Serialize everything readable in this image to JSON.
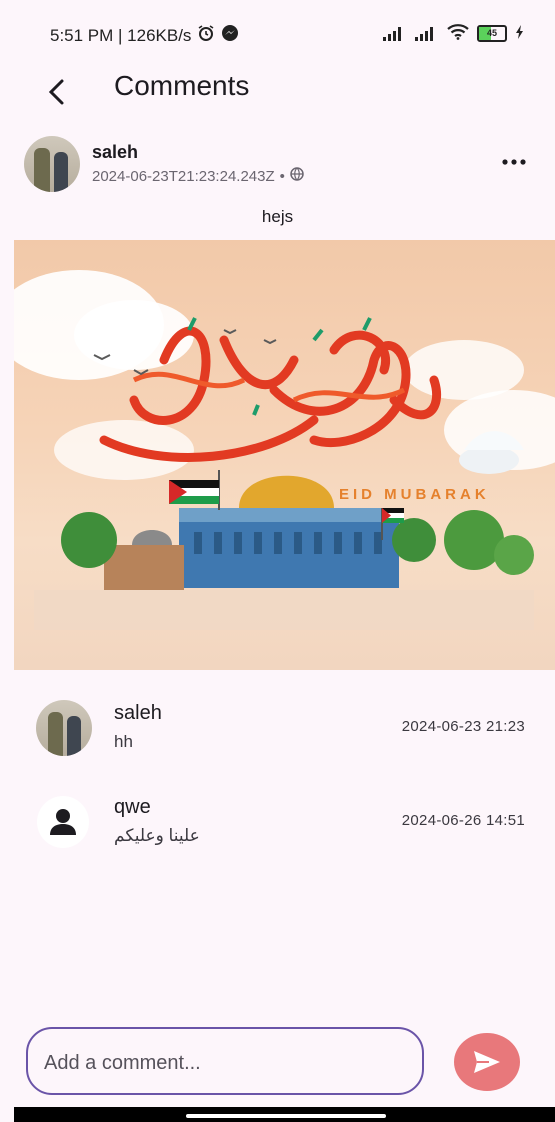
{
  "status_bar": {
    "time_speed": "5:51 PM | 126KB/s",
    "battery": "45",
    "icons": [
      "alarm-icon",
      "messenger-icon",
      "signal-icon",
      "signal-icon",
      "wifi-icon",
      "battery-icon",
      "charging-icon"
    ]
  },
  "app_bar": {
    "title": "Comments"
  },
  "post": {
    "author": "saleh",
    "timestamp": "2024-06-23T21:23:24.243Z",
    "separator": "•",
    "caption": "hejs",
    "image_text": "EID MUBARAK"
  },
  "comments": [
    {
      "author": "saleh",
      "text": "hh",
      "time": "2024-06-23 21:23",
      "avatar": "photo"
    },
    {
      "author": "qwe",
      "text": "علينا وعليكم",
      "time": "2024-06-26 14:51",
      "avatar": "person-icon"
    }
  ],
  "composer": {
    "placeholder": "Add a comment..."
  },
  "colors": {
    "background": "#fdf6fb",
    "accent": "#6a54a8",
    "send": "#e8787b"
  }
}
